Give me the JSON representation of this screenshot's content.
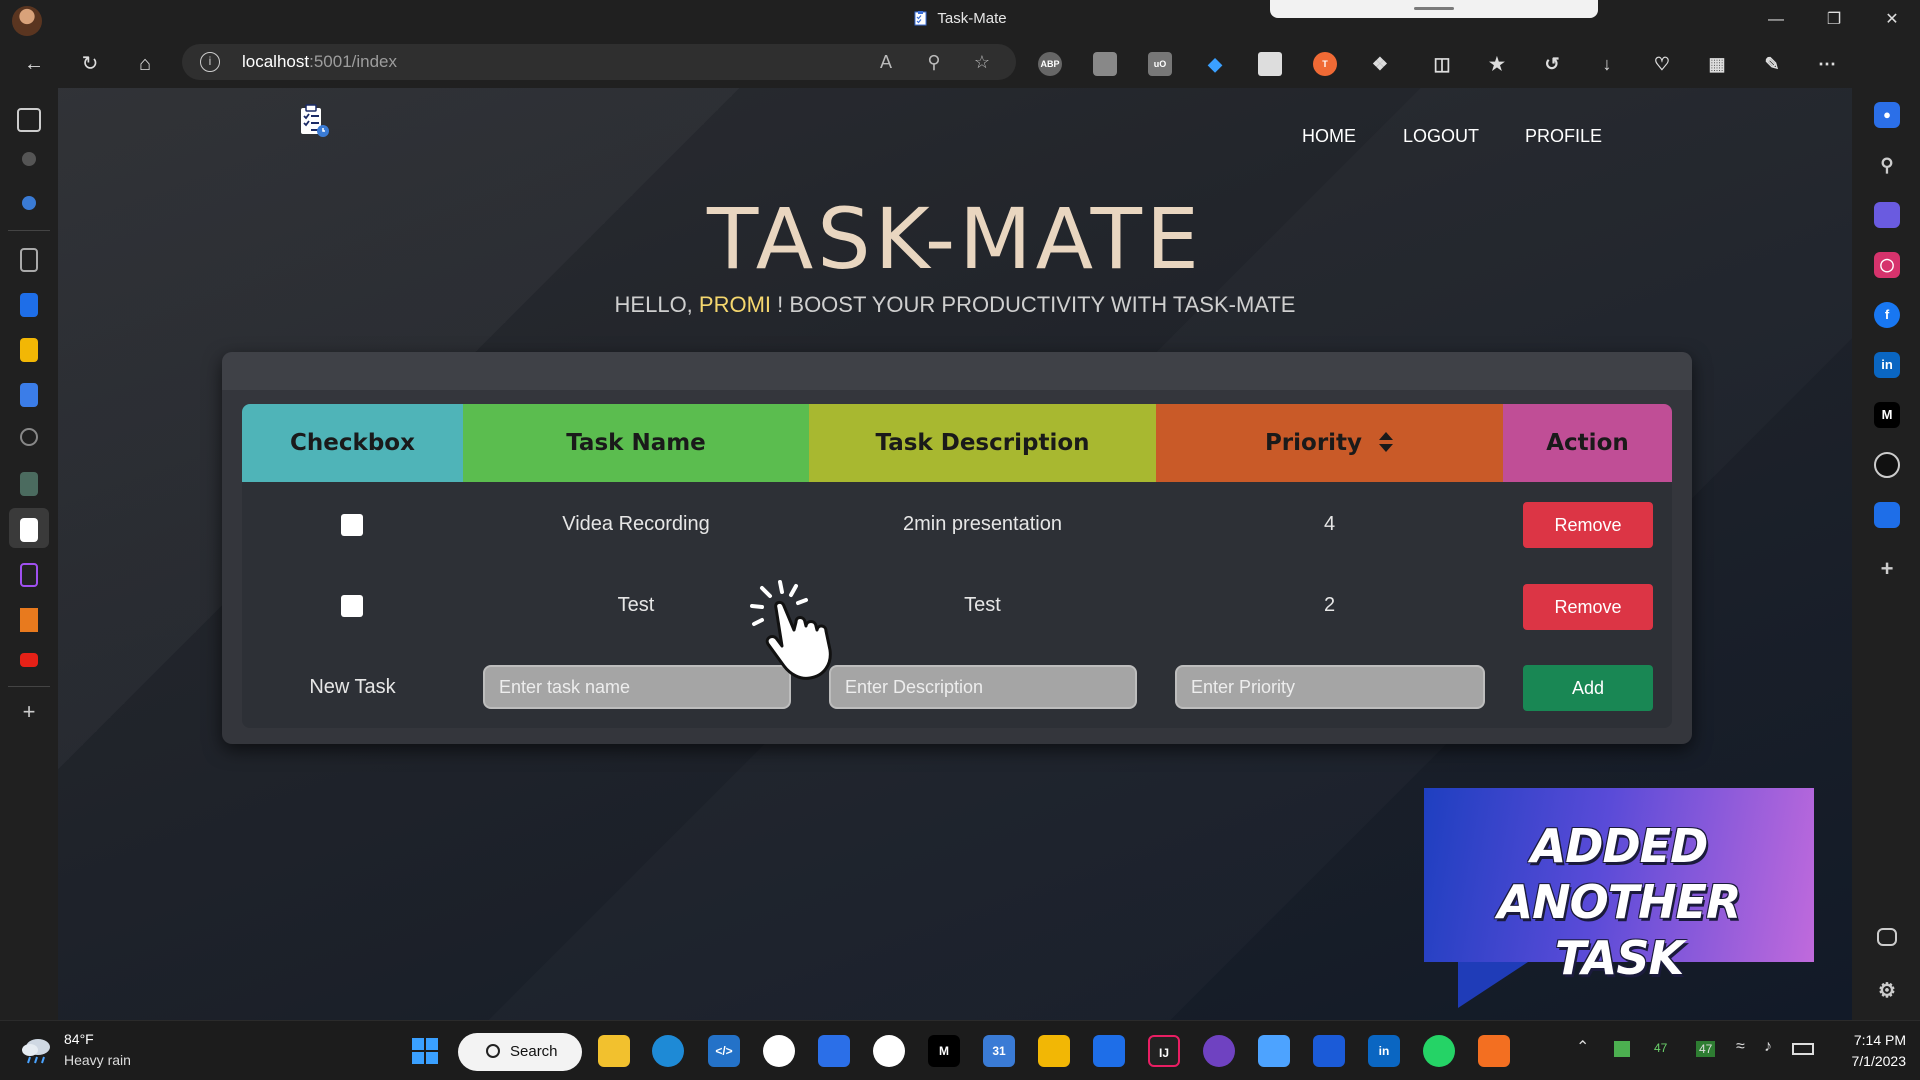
{
  "browser": {
    "window_title": "Task-Mate",
    "url_host": "localhost",
    "url_path": ":5001/index"
  },
  "page": {
    "nav": [
      "HOME",
      "LOGOUT",
      "PROFILE"
    ],
    "title": "TASK-MATE",
    "greeting_prefix": "HELLO,",
    "user_name": "PROMI",
    "greeting_suffix": "! BOOST YOUR PRODUCTIVITY WITH TASK-MATE"
  },
  "table": {
    "headers": {
      "checkbox": "Checkbox",
      "task_name": "Task Name",
      "description": "Task Description",
      "priority": "Priority",
      "action": "Action"
    },
    "header_colors": {
      "checkbox": "#4fb4b8",
      "task_name": "#5bbd4f",
      "description": "#a8b830",
      "priority": "#c95a28",
      "action": "#c04e96"
    },
    "rows": [
      {
        "name": "Videa Recording",
        "description": "2min presentation",
        "priority": "4",
        "action": "Remove"
      },
      {
        "name": "Test",
        "description": "Test",
        "priority": "2",
        "action": "Remove"
      }
    ],
    "new_task": {
      "label": "New Task",
      "name_placeholder": "Enter task name",
      "description_placeholder": "Enter Description",
      "priority_placeholder": "Enter Priority",
      "add_label": "Add"
    }
  },
  "overlay": {
    "line1": "ADDED ANOTHER",
    "line2": "TASK"
  },
  "taskbar": {
    "temperature": "84°F",
    "condition": "Heavy rain",
    "search_label": "Search",
    "tray_badge_1": "47",
    "tray_badge_2": "47",
    "time": "7:14 PM",
    "date": "7/1/2023"
  },
  "colors": {
    "title": "#e9d6c0",
    "username": "#f5d76e",
    "remove": "#dc3545",
    "add": "#198754"
  }
}
